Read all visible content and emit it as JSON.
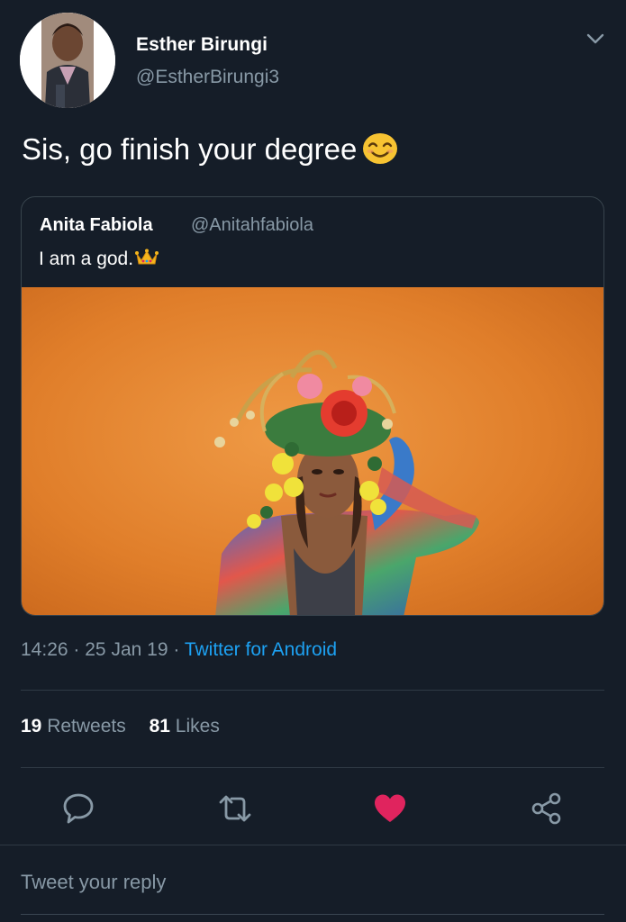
{
  "author": {
    "name": "Esther Birungi",
    "handle": "@EstherBirungi3"
  },
  "tweet": {
    "text": "Sis, go finish your degree",
    "emoji_icon": "smiling-face-emoji"
  },
  "quoted_tweet": {
    "name": "Anita Fabiola",
    "handle": "@Anitahfabiola",
    "text": "I am a god.",
    "emoji_icon": "crown-emoji",
    "image": "photo of woman in floral headdress against orange background"
  },
  "meta": {
    "time": "14:26",
    "separator": "·",
    "date": "25 Jan 19",
    "source": "Twitter for Android"
  },
  "stats": {
    "retweets_count": "19",
    "retweets_label": "Retweets",
    "likes_count": "81",
    "likes_label": "Likes"
  },
  "actions": [
    "reply-icon",
    "retweet-icon",
    "like-icon",
    "share-icon"
  ],
  "reply": {
    "placeholder": "Tweet your reply"
  },
  "colors": {
    "background": "#151d28",
    "secondary_text": "#8899a6",
    "link": "#1da1f2",
    "like": "#e0245e",
    "border": "#38444d"
  }
}
